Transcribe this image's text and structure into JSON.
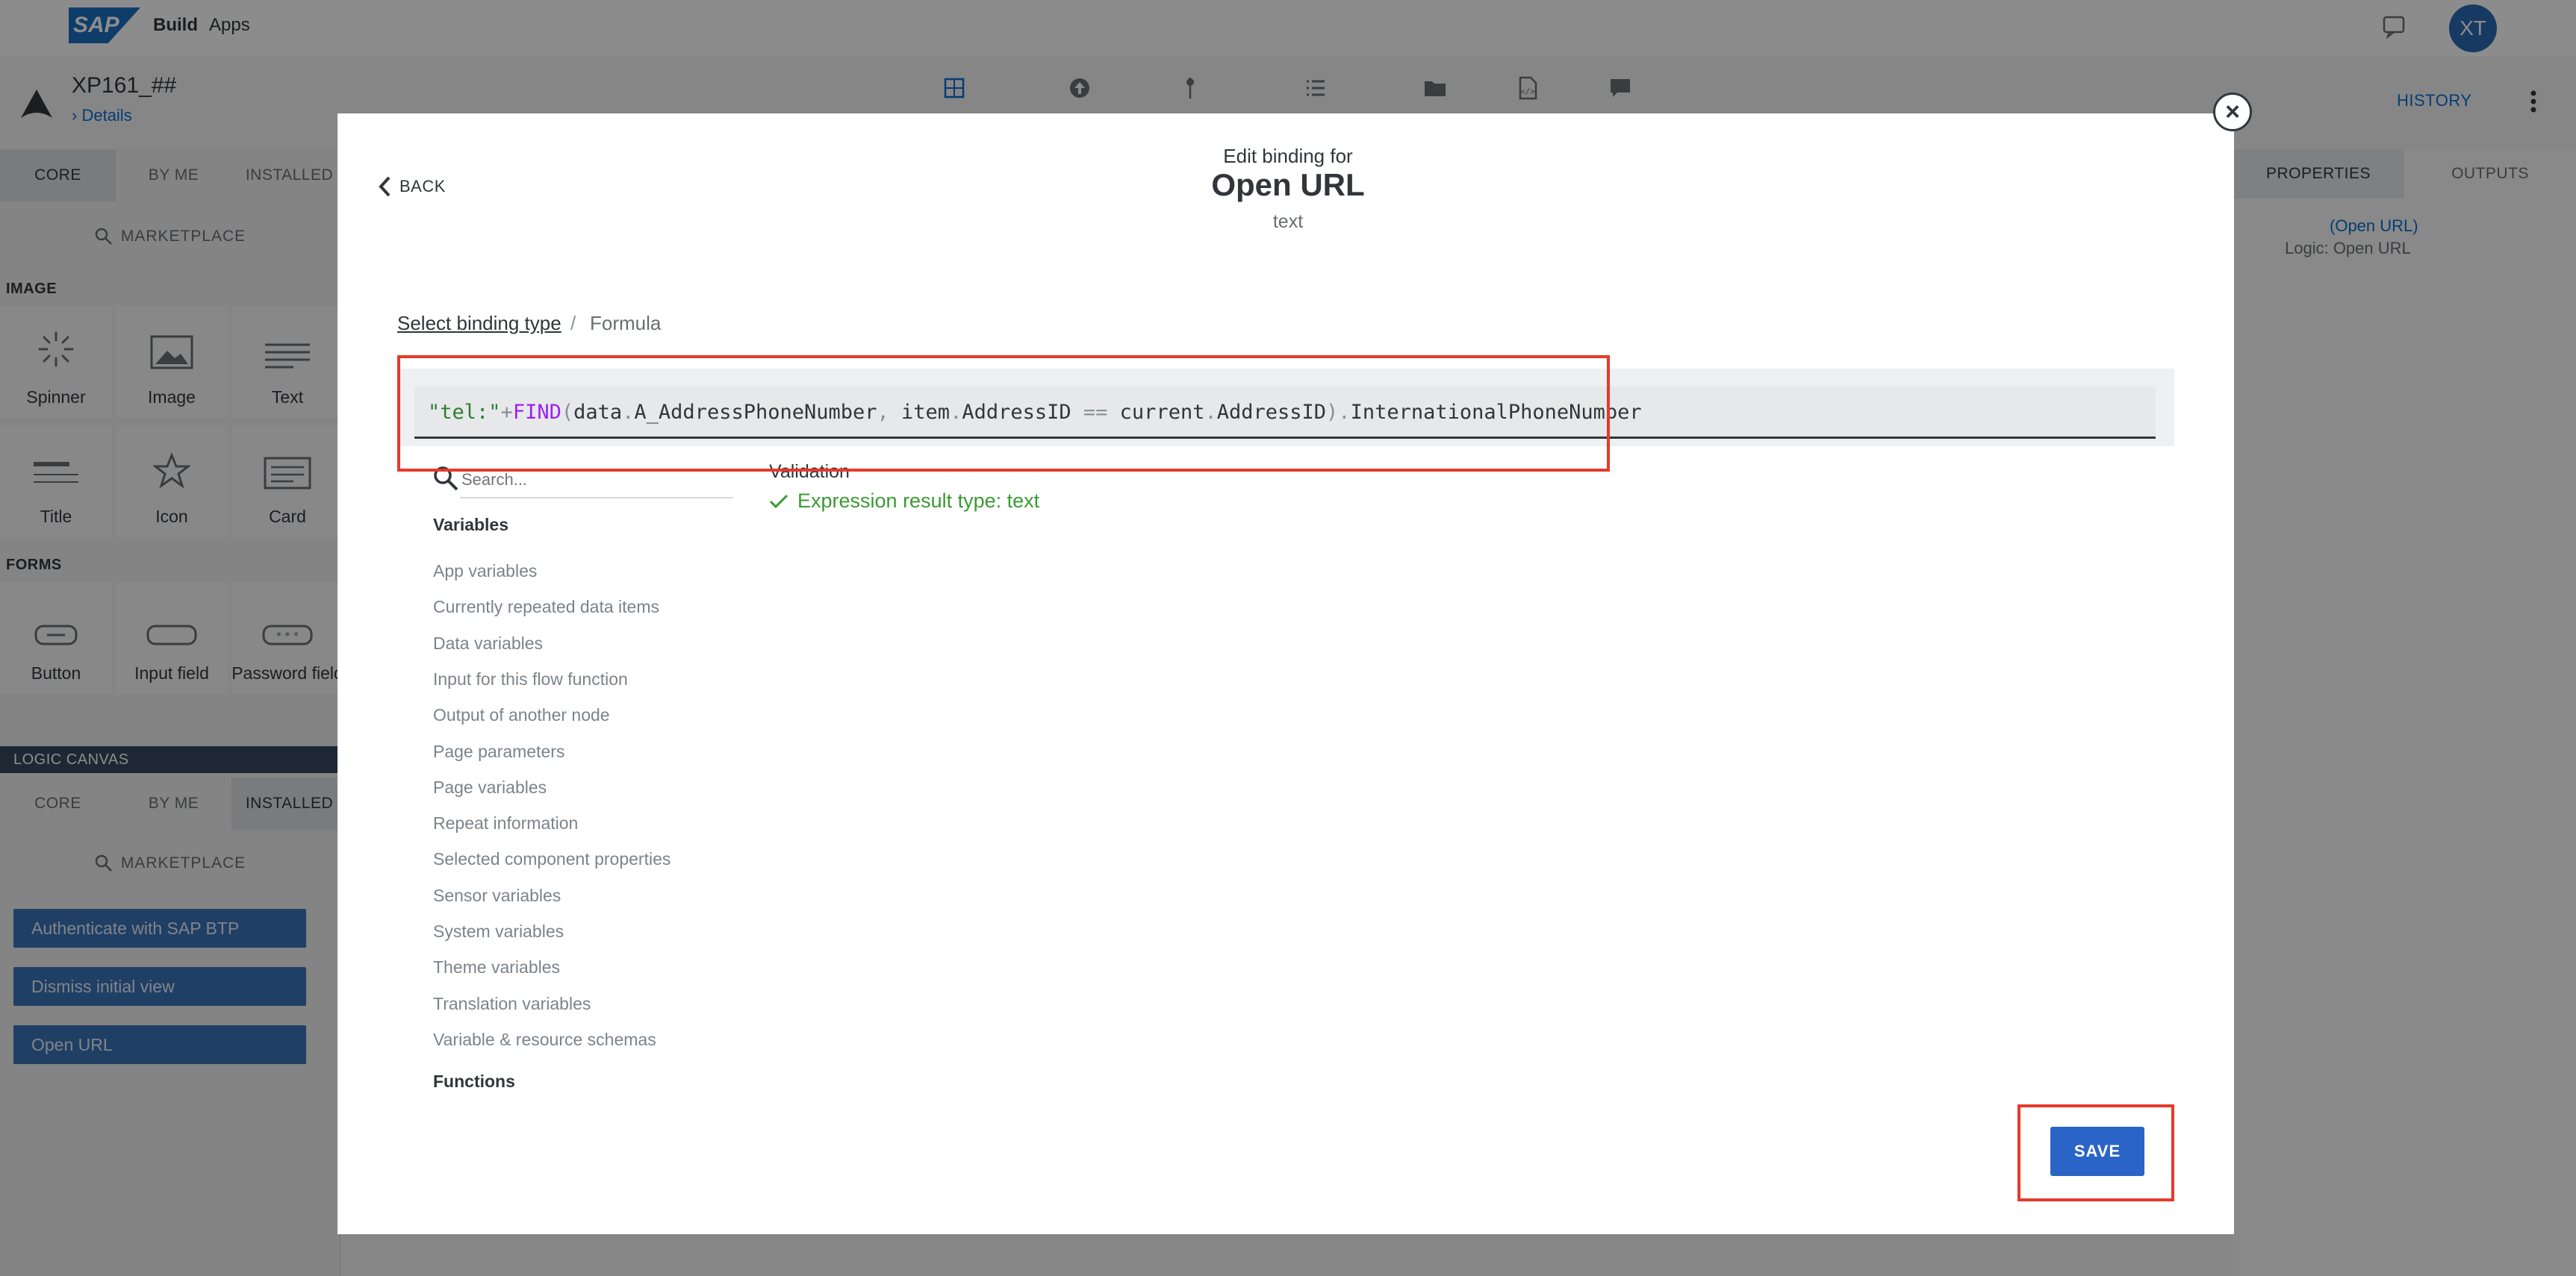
{
  "topbar": {
    "brand_logo": "SAP",
    "brand_build": "Build",
    "brand_apps": "Apps",
    "avatar_initials": "XT"
  },
  "project": {
    "name": "XP161_##",
    "details_link": "Details"
  },
  "left_panel": {
    "tabs": [
      "CORE",
      "BY ME",
      "INSTALLED"
    ],
    "marketplace": "MARKETPLACE",
    "sections": {
      "image": "IMAGE",
      "forms": "FORMS"
    },
    "image_components": [
      "Spinner",
      "Image",
      "Text",
      "Title",
      "Icon",
      "Card"
    ],
    "form_components": [
      "Button",
      "Input field",
      "Password field"
    ],
    "logic_canvas": "LOGIC CANVAS",
    "logic_tabs": [
      "CORE",
      "BY ME",
      "INSTALLED"
    ],
    "logic_marketplace": "MARKETPLACE",
    "flow_items": [
      "Authenticate with SAP BTP",
      "Dismiss initial view",
      "Open URL"
    ]
  },
  "right_panel": {
    "history": "HISTORY",
    "tabs": [
      "PROPERTIES",
      "OUTPUTS"
    ],
    "component_title": "(Open URL)",
    "component_subtitle": "Logic: Open URL"
  },
  "dialog": {
    "back_label": "BACK",
    "subtitle": "Edit binding for",
    "title": "Open URL",
    "type": "text",
    "breadcrumb_link": "Select binding type",
    "breadcrumb_sep": "/",
    "breadcrumb_current": "Formula",
    "formula_tokens": [
      {
        "t": "\"tel:\"",
        "c": "str"
      },
      {
        "t": "+",
        "c": "op"
      },
      {
        "t": "FIND",
        "c": "fn"
      },
      {
        "t": "(",
        "c": "op"
      },
      {
        "t": "data",
        "c": "id"
      },
      {
        "t": ".",
        "c": "op"
      },
      {
        "t": "A_AddressPhoneNumber",
        "c": "id"
      },
      {
        "t": ", ",
        "c": "op"
      },
      {
        "t": "item",
        "c": "id"
      },
      {
        "t": ".",
        "c": "op"
      },
      {
        "t": "AddressID ",
        "c": "id"
      },
      {
        "t": "== ",
        "c": "op"
      },
      {
        "t": "current",
        "c": "id"
      },
      {
        "t": ".",
        "c": "op"
      },
      {
        "t": "AddressID",
        "c": "id"
      },
      {
        "t": ").",
        "c": "op"
      },
      {
        "t": "InternationalPhoneNumber",
        "c": "id"
      }
    ],
    "search_placeholder": "Search...",
    "variables_heading": "Variables",
    "variable_items": [
      "App variables",
      "Currently repeated data items",
      "Data variables",
      "Input for this flow function",
      "Output of another node",
      "Page parameters",
      "Page variables",
      "Repeat information",
      "Selected component properties",
      "Sensor variables",
      "System variables",
      "Theme variables",
      "Translation variables",
      "Variable & resource schemas"
    ],
    "functions_heading": "Functions",
    "validation_label": "Validation",
    "validation_result": "Expression result type: text",
    "save_label": "SAVE"
  },
  "colors": {
    "accent": "#2a64c6",
    "highlight": "#e53a2b",
    "success": "#3a9a32",
    "function": "#a020f0",
    "string": "#2e7d32"
  }
}
